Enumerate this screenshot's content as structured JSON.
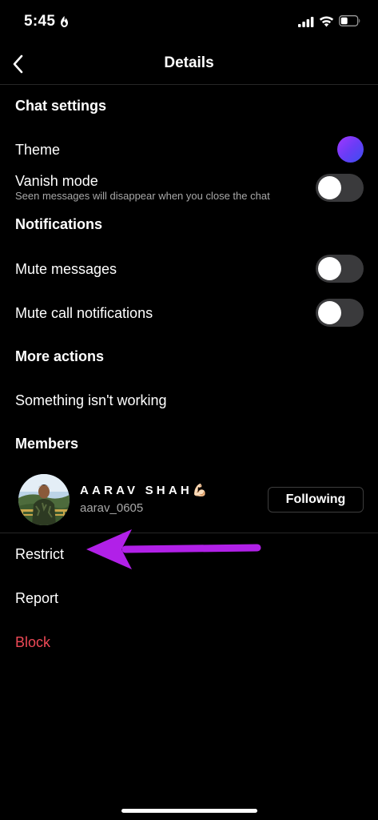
{
  "status": {
    "time": "5:45"
  },
  "nav": {
    "title": "Details"
  },
  "chat_settings": {
    "heading": "Chat settings",
    "theme_label": "Theme",
    "theme_color": "#7b3ff6",
    "vanish_label": "Vanish mode",
    "vanish_sub": "Seen messages will disappear when you close the chat",
    "vanish_on": false
  },
  "notifications": {
    "heading": "Notifications",
    "mute_messages_label": "Mute messages",
    "mute_messages_on": false,
    "mute_calls_label": "Mute call notifications",
    "mute_calls_on": false
  },
  "more_actions": {
    "heading": "More actions",
    "issue_label": "Something isn't working"
  },
  "members": {
    "heading": "Members",
    "name": "AARAV SHAH💪🏻",
    "username": "aarav_0605",
    "button_label": "Following"
  },
  "actions": {
    "restrict": "Restrict",
    "report": "Report",
    "block": "Block"
  },
  "annotation": {
    "arrow_color": "#b120e8"
  }
}
